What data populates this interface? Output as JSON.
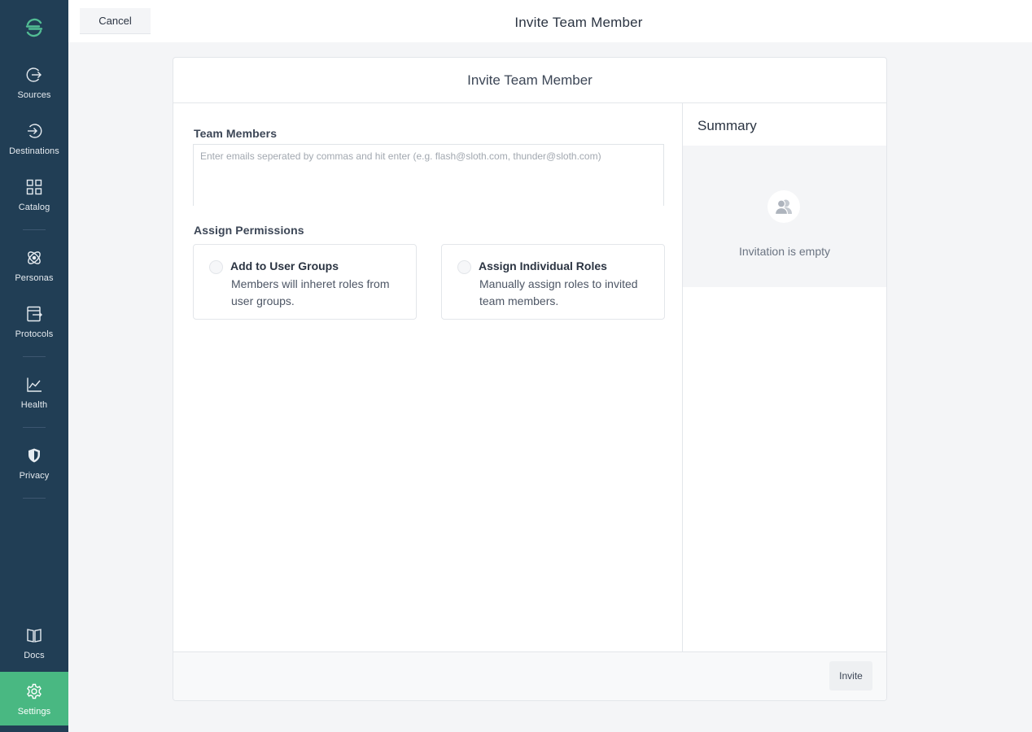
{
  "sidebar": {
    "items": [
      {
        "label": "Sources",
        "icon": "sources-icon"
      },
      {
        "label": "Destinations",
        "icon": "destinations-icon"
      },
      {
        "label": "Catalog",
        "icon": "catalog-icon"
      },
      {
        "label": "Personas",
        "icon": "personas-icon"
      },
      {
        "label": "Protocols",
        "icon": "protocols-icon"
      },
      {
        "label": "Health",
        "icon": "health-icon"
      },
      {
        "label": "Privacy",
        "icon": "privacy-icon"
      },
      {
        "label": "Docs",
        "icon": "docs-icon"
      },
      {
        "label": "Settings",
        "icon": "settings-icon",
        "active": true
      }
    ]
  },
  "header": {
    "cancel_label": "Cancel",
    "title": "Invite Team Member"
  },
  "modal": {
    "title": "Invite Team Member",
    "team_members_label": "Team Members",
    "email_placeholder": "Enter emails seperated by commas and hit enter (e.g. flash@sloth.com, thunder@sloth.com)",
    "email_value": "",
    "permissions_label": "Assign Permissions",
    "options": [
      {
        "title": "Add to User Groups",
        "description": "Members will inheret roles from user groups.",
        "selected": false
      },
      {
        "title": "Assign Individual Roles",
        "description": "Manually assign roles to invited team members.",
        "selected": false
      }
    ],
    "summary_title": "Summary",
    "summary_empty": "Invitation is empty",
    "invite_label": "Invite"
  },
  "colors": {
    "sidebar_bg": "#213e55",
    "active_green": "#49b882",
    "page_bg": "#f4f5f7"
  }
}
